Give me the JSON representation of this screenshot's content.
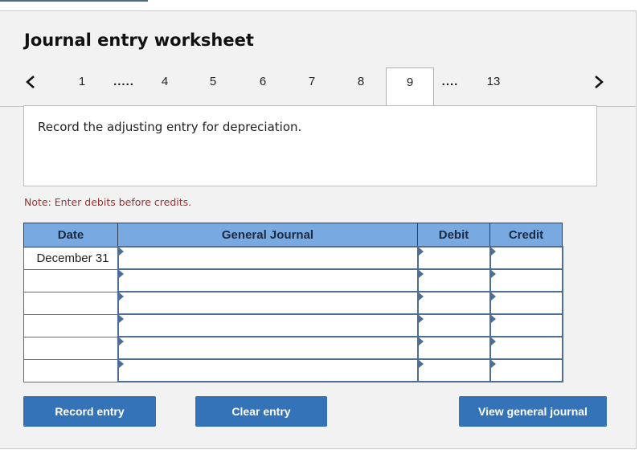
{
  "title": "Journal entry worksheet",
  "pager": {
    "prev_icon": "chevron-left-icon",
    "next_icon": "chevron-right-icon",
    "items": [
      {
        "label": "1",
        "type": "page"
      },
      {
        "label": ".....",
        "type": "ellipsis"
      },
      {
        "label": "4",
        "type": "page"
      },
      {
        "label": "5",
        "type": "page"
      },
      {
        "label": "6",
        "type": "page"
      },
      {
        "label": "7",
        "type": "page"
      },
      {
        "label": "8",
        "type": "page"
      },
      {
        "label": "9",
        "type": "page",
        "active": true
      },
      {
        "label": "....",
        "type": "ellipsis"
      },
      {
        "label": "13",
        "type": "page"
      }
    ],
    "active_page": "9"
  },
  "prompt": "Record the adjusting entry for depreciation.",
  "note": "Note: Enter debits before credits.",
  "table": {
    "headers": [
      "Date",
      "General Journal",
      "Debit",
      "Credit"
    ],
    "rows": [
      {
        "date": "December 31",
        "account": "",
        "debit": "",
        "credit": ""
      },
      {
        "date": "",
        "account": "",
        "debit": "",
        "credit": ""
      },
      {
        "date": "",
        "account": "",
        "debit": "",
        "credit": ""
      },
      {
        "date": "",
        "account": "",
        "debit": "",
        "credit": ""
      },
      {
        "date": "",
        "account": "",
        "debit": "",
        "credit": ""
      },
      {
        "date": "",
        "account": "",
        "debit": "",
        "credit": ""
      }
    ]
  },
  "buttons": {
    "record": "Record entry",
    "clear": "Clear entry",
    "view": "View general journal"
  },
  "colors": {
    "header_bg": "#78a9e0",
    "button_bg": "#3573b8",
    "note_text": "#a03030",
    "input_border": "#4d6f96"
  }
}
